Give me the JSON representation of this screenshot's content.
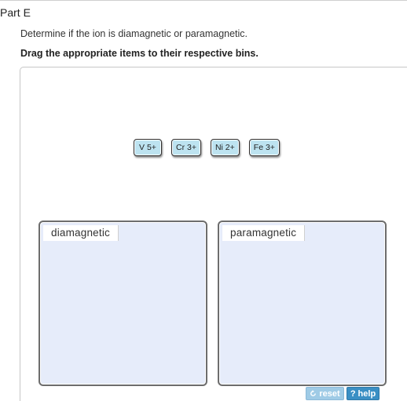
{
  "part": {
    "title": "Part E"
  },
  "instructions": {
    "question": "Determine if the ion is diamagnetic or paramagnetic.",
    "directive": "Drag the appropriate items to their respective bins."
  },
  "tiles": [
    {
      "label": "V 5+"
    },
    {
      "label": "Cr 3+"
    },
    {
      "label": "Ni 2+"
    },
    {
      "label": "Fe 3+"
    }
  ],
  "bins": {
    "left": {
      "label": "diamagnetic"
    },
    "right": {
      "label": "paramagnetic"
    }
  },
  "buttons": {
    "reset": {
      "label": "reset",
      "icon": "reset-icon"
    },
    "help": {
      "label": "help",
      "icon": "question-mark-icon"
    }
  },
  "colors": {
    "tile_fill": "#bde3f0",
    "bin_fill": "#e6ecfa",
    "reset_button": "#9fcbe6",
    "help_button": "#3a8fc4"
  }
}
